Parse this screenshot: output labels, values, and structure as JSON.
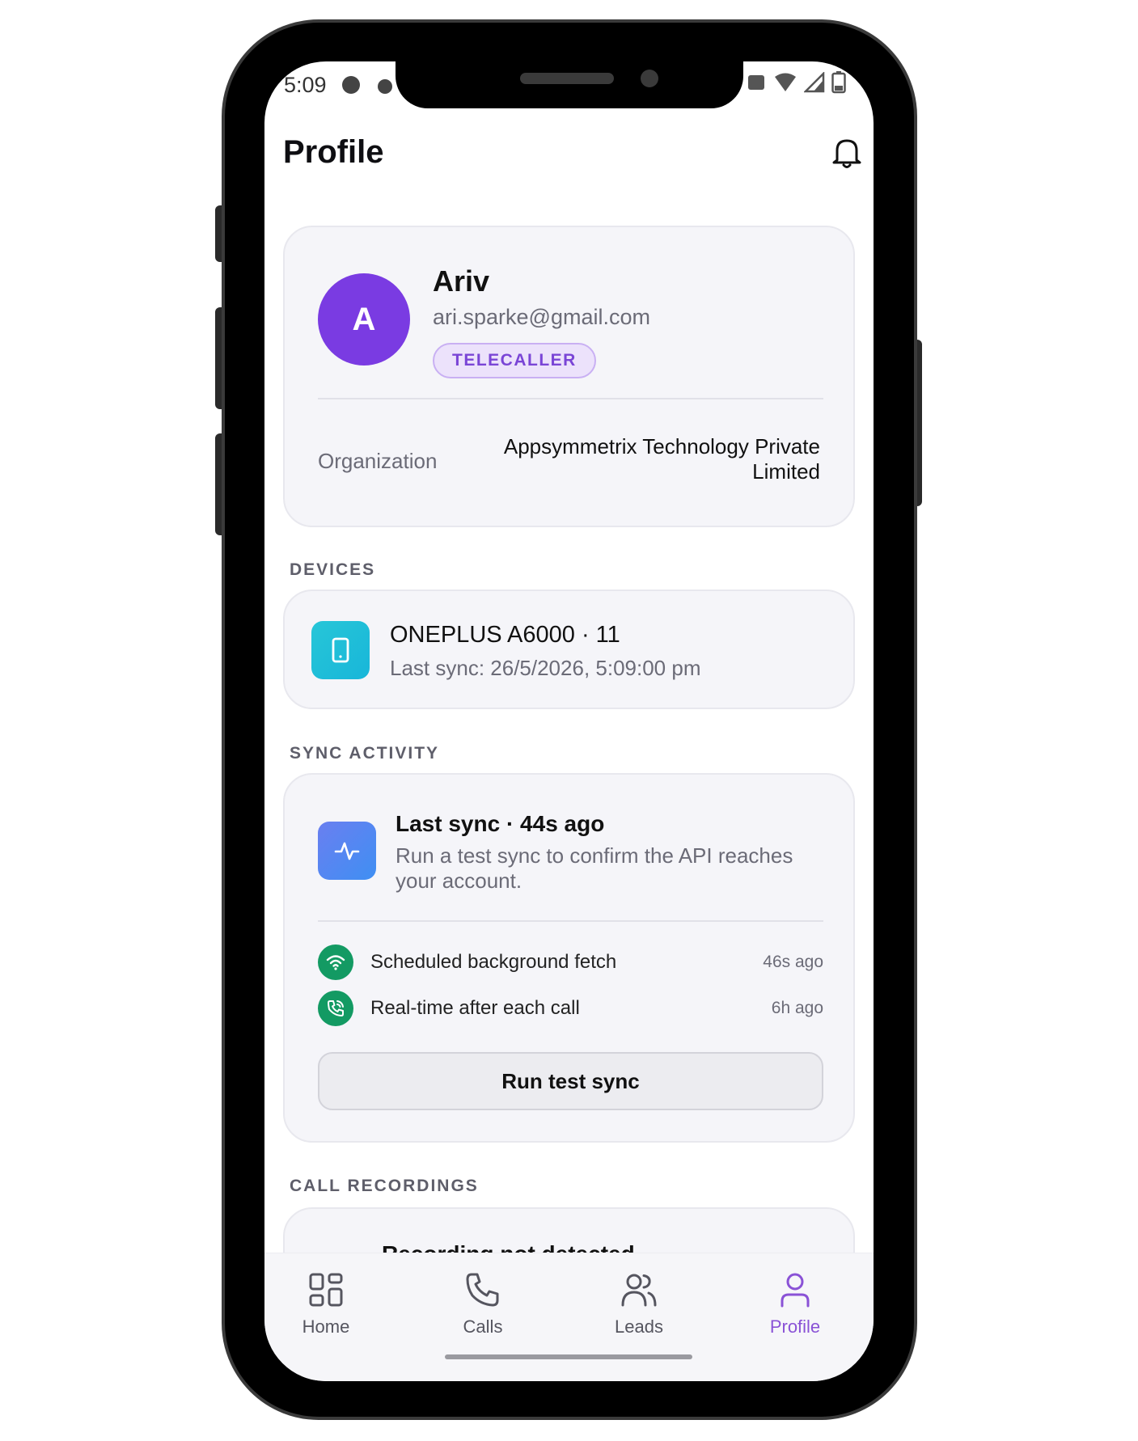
{
  "status_bar": {
    "time": "5:09"
  },
  "header": {
    "title": "Profile"
  },
  "profile": {
    "avatar_initial": "A",
    "name": "Ariv",
    "email": "ari.sparke@gmail.com",
    "role": "TELECALLER",
    "organization_label": "Organization",
    "organization_value": "Appsymmetrix Technology Private Limited"
  },
  "devices": {
    "section_label": "DEVICES",
    "items": [
      {
        "name": "ONEPLUS A6000 · 11",
        "last_sync": "Last sync: 26/5/2026, 5:09:00 pm"
      }
    ]
  },
  "sync_activity": {
    "section_label": "SYNC ACTIVITY",
    "title": "Last sync · 44s ago",
    "description": "Run a test sync to confirm the API reaches your account.",
    "rows": [
      {
        "label": "Scheduled background fetch",
        "time": "46s ago",
        "icon": "wifi-icon"
      },
      {
        "label": "Real-time after each call",
        "time": "6h ago",
        "icon": "phone-call-icon"
      }
    ],
    "button_label": "Run test sync"
  },
  "call_recordings": {
    "section_label": "CALL RECORDINGS",
    "title": "Recording not detected"
  },
  "bottom_nav": {
    "items": [
      {
        "label": "Home",
        "icon": "grid-icon"
      },
      {
        "label": "Calls",
        "icon": "phone-icon"
      },
      {
        "label": "Leads",
        "icon": "users-icon"
      },
      {
        "label": "Profile",
        "icon": "user-icon"
      }
    ],
    "active": "Profile"
  },
  "colors": {
    "accent": "#7a3be2",
    "active_nav": "#8a52d6",
    "status_green": "#139a63",
    "device_cyan": "#1fbfd9",
    "sync_blue": "#4f86f2"
  }
}
